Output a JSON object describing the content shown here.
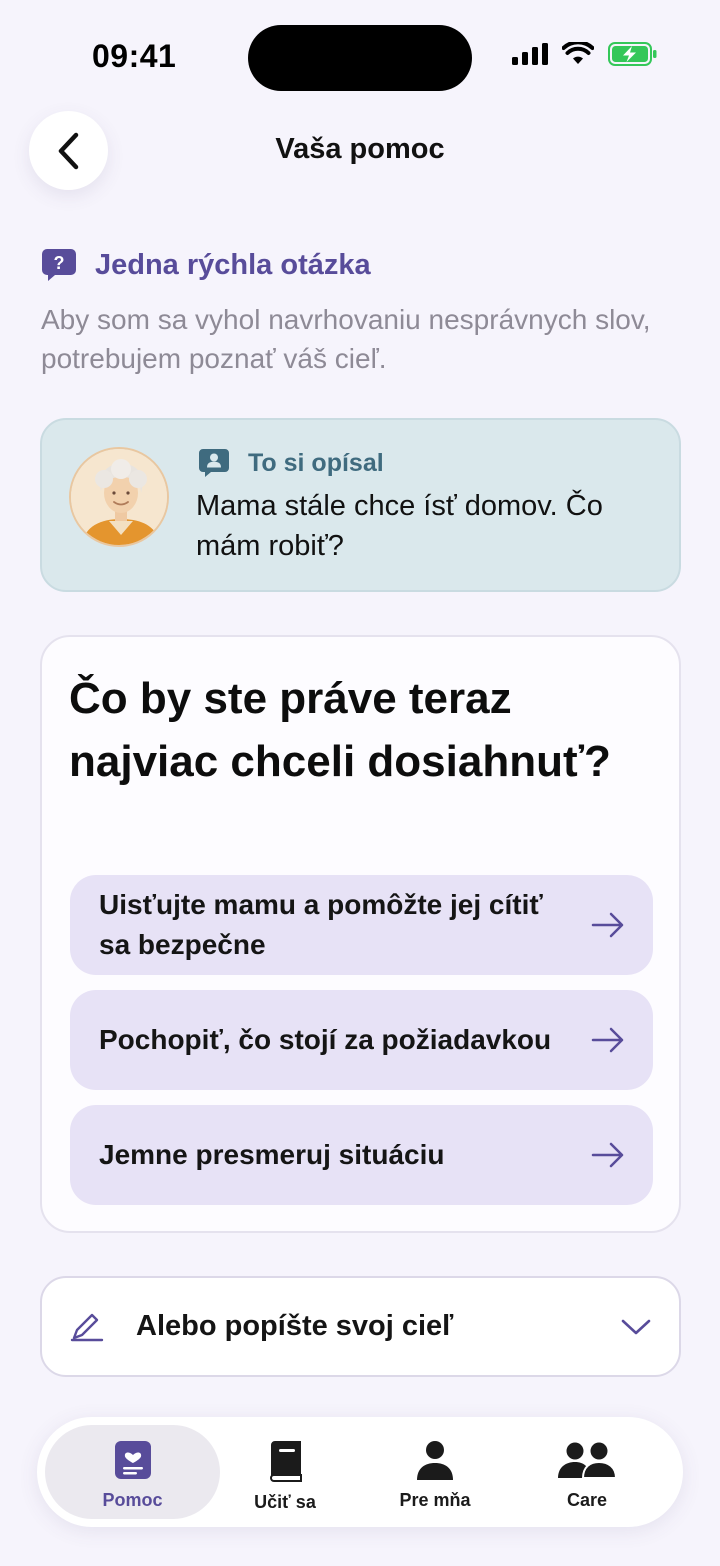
{
  "status_bar": {
    "time": "09:41"
  },
  "header": {
    "title": "Vaša pomoc"
  },
  "question": {
    "title": "Jedna rýchla otázka",
    "description": "Aby som sa vyhol navrhovaniu nesprávnych slov, potrebujem poznať váš cieľ."
  },
  "described": {
    "label": "To si opísal",
    "text": "Mama stále chce ísť domov. Čo mám robiť?"
  },
  "goal": {
    "question": "Čo by ste práve teraz najviac chceli dosiahnuť?",
    "options": [
      {
        "label": "Uisťujte mamu a pomôžte jej cítiť sa bezpečne"
      },
      {
        "label": "Pochopiť, čo stojí za požiadavkou"
      },
      {
        "label": "Jemne presmeruj situáciu"
      }
    ]
  },
  "custom_goal": {
    "label": "Alebo popíšte svoj cieľ"
  },
  "tabs": [
    {
      "label": "Pomoc",
      "icon": "care-notebook-icon",
      "active": true
    },
    {
      "label": "Učiť sa",
      "icon": "book-icon",
      "active": false
    },
    {
      "label": "Pre mňa",
      "icon": "person-icon",
      "active": false
    },
    {
      "label": "Care",
      "icon": "people-icon",
      "active": false
    }
  ],
  "colors": {
    "accent": "#584c9a",
    "background": "#f6f4fc",
    "described_card": "#dae8ec",
    "option_bg": "#e7e2f6",
    "battery": "#34c759"
  }
}
